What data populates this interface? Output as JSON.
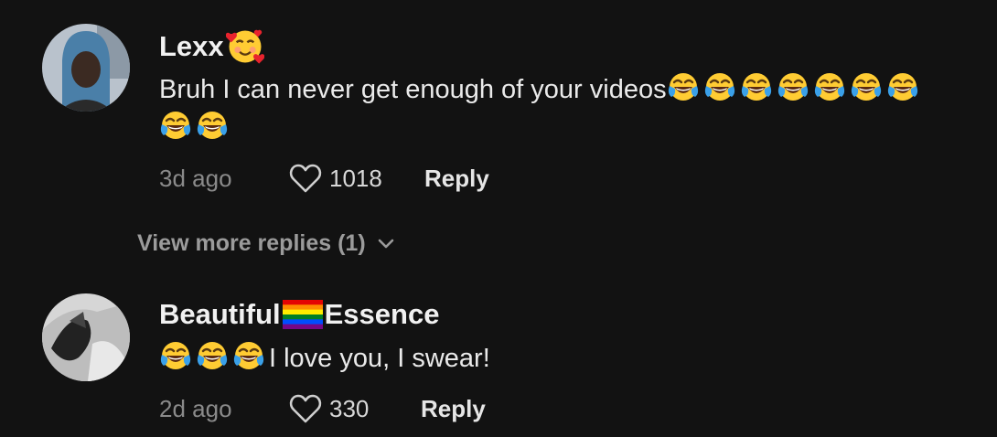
{
  "comments": [
    {
      "username": "Lexx",
      "username_emoji": "smiling-face-with-hearts-icon",
      "text_line1": "Bruh I can never get enough of your videos",
      "emoji_count_line1": 7,
      "emoji_count_line2": 2,
      "emoji": "face-with-tears-of-joy-icon",
      "time": "3d ago",
      "likes": "1018",
      "reply_label": "Reply"
    },
    {
      "username_part1": "Beautiful",
      "username_flag": "rainbow-flag-icon",
      "username_part2": "Essence",
      "leading_emoji_count": 3,
      "emoji": "face-with-tears-of-joy-icon",
      "text": "I love you, I swear!",
      "time": "2d ago",
      "likes": "330",
      "reply_label": "Reply"
    }
  ],
  "view_more_label": "View more replies (1)",
  "colors": {
    "background": "#121212",
    "primary_text": "#f1f1f1",
    "secondary_text": "#8a8a8a"
  }
}
